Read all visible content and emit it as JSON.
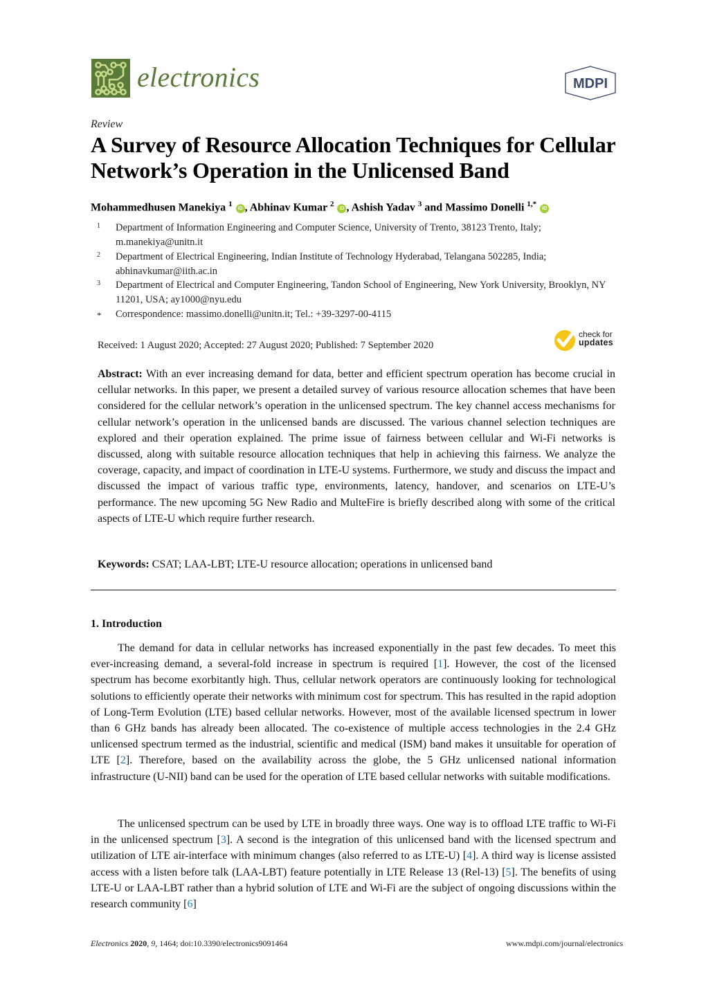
{
  "header": {
    "journal_name": "electronics",
    "publisher": "MDPI",
    "journal_logo_icon": "circuit-board-icon",
    "brand_color": "#5a7a3a"
  },
  "article": {
    "type": "Review",
    "title": "A Survey of Resource Allocation Techniques for Cellular Network’s Operation in the Unlicensed Band",
    "authors": [
      {
        "name": "Mohammedhusen Manekiya",
        "affil": "1"
      },
      {
        "name": "Abhinav Kumar",
        "affil": "2"
      },
      {
        "name": "Ashish Yadav",
        "affil": "3"
      },
      {
        "name": "Massimo Donelli",
        "affil": "1,*"
      }
    ],
    "author_sep_1": ", ",
    "author_sep_2": ", ",
    "author_sep_3": " and ",
    "orcid_label": "iD",
    "affiliations": [
      {
        "num": "1",
        "text": "Department of Information Engineering and Computer Science, University of Trento, 38123 Trento, Italy; m.manekiya@unitn.it"
      },
      {
        "num": "2",
        "text": "Department of Electrical Engineering, Indian Institute of Technology Hyderabad, Telangana 502285, India; abhinavkumar@iith.ac.in"
      },
      {
        "num": "3",
        "text": "Department of Electrical and Computer Engineering, Tandon School of Engineering, New York University, Brooklyn, NY 11201, USA; ay1000@nyu.edu"
      },
      {
        "num": "*",
        "text": "Correspondence: massimo.donelli@unitn.it; Tel.: +39-3297-00-4115"
      }
    ],
    "dates": "Received: 1 August 2020; Accepted: 27 August 2020; Published: 7 September 2020",
    "check_updates": {
      "line1": "check for",
      "line2": "updates"
    },
    "abstract_label": "Abstract:",
    "abstract": "With an ever increasing demand for data, better and efficient spectrum operation has become crucial in cellular networks. In this paper, we present a detailed survey of various resource allocation schemes that have been considered for the cellular network’s operation in the unlicensed spectrum. The key channel access mechanisms for cellular network’s operation in the unlicensed bands are discussed. The various channel selection techniques are explored and their operation explained. The prime issue of fairness between cellular and Wi-Fi networks is discussed, along with suitable resource allocation techniques that help in achieving this fairness. We analyze the coverage, capacity, and impact of coordination in LTE-U systems. Furthermore, we study and discuss the impact and discussed the impact of various traffic type, environments, latency, handover, and scenarios on LTE-U’s performance. The new upcoming 5G New Radio and MulteFire is briefly described along with some of the critical aspects of LTE-U which require further research.",
    "keywords_label": "Keywords:",
    "keywords": "CSAT; LAA-LBT; LTE-U resource allocation; operations in unlicensed band"
  },
  "section": {
    "heading": "1. Introduction",
    "p1": [
      "The demand for data in cellular networks has increased exponentially in the past few decades. To meet this ever-increasing demand, a several-fold increase in spectrum is required [",
      "1",
      "]. However, the cost of the licensed spectrum has become exorbitantly high. Thus, cellular network operators are continuously looking for technological solutions to efficiently operate their networks with minimum cost for spectrum. This has resulted in the rapid adoption of Long-Term Evolution (LTE) based cellular networks. However, most of the available licensed spectrum in lower than 6 GHz bands has already been allocated. The co-existence of multiple access technologies in the 2.4 GHz unlicensed spectrum termed as the industrial, scientific and medical (ISM) band makes it unsuitable for operation of LTE [",
      "2",
      "]. Therefore, based on the availability across the globe, the 5 GHz unlicensed national information infrastructure (U-NII) band can be used for the operation of LTE based cellular networks with suitable modifications."
    ],
    "p2": [
      "The unlicensed spectrum can be used by LTE in broadly three ways. One way is to offload LTE traffic to Wi-Fi in the unlicensed spectrum [",
      "3",
      "]. A second is the integration of this unlicensed band with the licensed spectrum and utilization of LTE air-interface with minimum changes (also referred to as LTE-U) [",
      "4",
      "]. A third way is license assisted access with a listen before talk (LAA-LBT) feature potentially in LTE Release 13 (Rel-13) [",
      "5",
      "]. The benefits of using LTE-U or LAA-LBT rather than a hybrid solution of LTE and Wi-Fi are the subject of ongoing discussions within the research community [",
      "6",
      "]"
    ],
    "ref_color": "#1a7ab8"
  },
  "footer": {
    "journal": "Electronics",
    "year": "2020",
    "volume": "9",
    "article_info": ", 1464; doi:10.3390/electronics9091464",
    "url": "www.mdpi.com/journal/electronics"
  }
}
